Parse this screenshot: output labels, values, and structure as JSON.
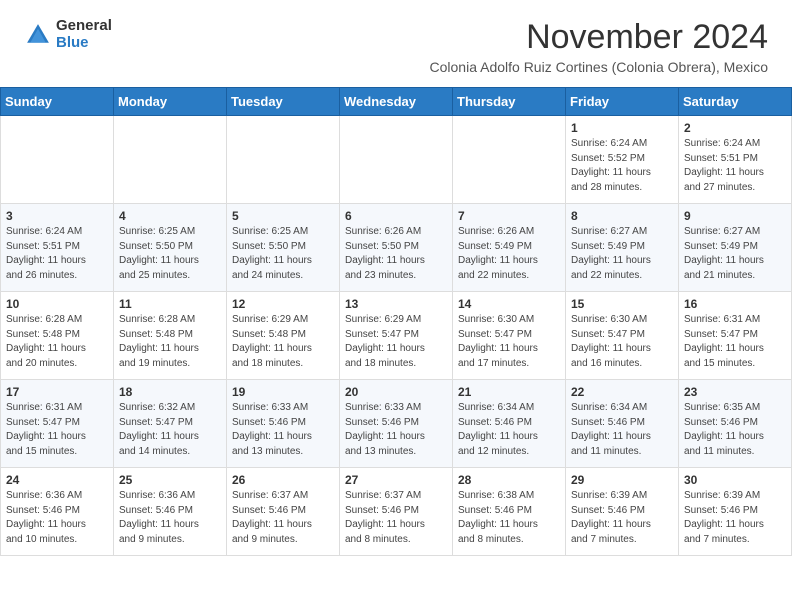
{
  "header": {
    "logo_general": "General",
    "logo_blue": "Blue",
    "month_title": "November 2024",
    "subtitle": "Colonia Adolfo Ruiz Cortines (Colonia Obrera), Mexico"
  },
  "days_of_week": [
    "Sunday",
    "Monday",
    "Tuesday",
    "Wednesday",
    "Thursday",
    "Friday",
    "Saturday"
  ],
  "weeks": [
    [
      {
        "num": "",
        "detail": ""
      },
      {
        "num": "",
        "detail": ""
      },
      {
        "num": "",
        "detail": ""
      },
      {
        "num": "",
        "detail": ""
      },
      {
        "num": "",
        "detail": ""
      },
      {
        "num": "1",
        "detail": "Sunrise: 6:24 AM\nSunset: 5:52 PM\nDaylight: 11 hours\nand 28 minutes."
      },
      {
        "num": "2",
        "detail": "Sunrise: 6:24 AM\nSunset: 5:51 PM\nDaylight: 11 hours\nand 27 minutes."
      }
    ],
    [
      {
        "num": "3",
        "detail": "Sunrise: 6:24 AM\nSunset: 5:51 PM\nDaylight: 11 hours\nand 26 minutes."
      },
      {
        "num": "4",
        "detail": "Sunrise: 6:25 AM\nSunset: 5:50 PM\nDaylight: 11 hours\nand 25 minutes."
      },
      {
        "num": "5",
        "detail": "Sunrise: 6:25 AM\nSunset: 5:50 PM\nDaylight: 11 hours\nand 24 minutes."
      },
      {
        "num": "6",
        "detail": "Sunrise: 6:26 AM\nSunset: 5:50 PM\nDaylight: 11 hours\nand 23 minutes."
      },
      {
        "num": "7",
        "detail": "Sunrise: 6:26 AM\nSunset: 5:49 PM\nDaylight: 11 hours\nand 22 minutes."
      },
      {
        "num": "8",
        "detail": "Sunrise: 6:27 AM\nSunset: 5:49 PM\nDaylight: 11 hours\nand 22 minutes."
      },
      {
        "num": "9",
        "detail": "Sunrise: 6:27 AM\nSunset: 5:49 PM\nDaylight: 11 hours\nand 21 minutes."
      }
    ],
    [
      {
        "num": "10",
        "detail": "Sunrise: 6:28 AM\nSunset: 5:48 PM\nDaylight: 11 hours\nand 20 minutes."
      },
      {
        "num": "11",
        "detail": "Sunrise: 6:28 AM\nSunset: 5:48 PM\nDaylight: 11 hours\nand 19 minutes."
      },
      {
        "num": "12",
        "detail": "Sunrise: 6:29 AM\nSunset: 5:48 PM\nDaylight: 11 hours\nand 18 minutes."
      },
      {
        "num": "13",
        "detail": "Sunrise: 6:29 AM\nSunset: 5:47 PM\nDaylight: 11 hours\nand 18 minutes."
      },
      {
        "num": "14",
        "detail": "Sunrise: 6:30 AM\nSunset: 5:47 PM\nDaylight: 11 hours\nand 17 minutes."
      },
      {
        "num": "15",
        "detail": "Sunrise: 6:30 AM\nSunset: 5:47 PM\nDaylight: 11 hours\nand 16 minutes."
      },
      {
        "num": "16",
        "detail": "Sunrise: 6:31 AM\nSunset: 5:47 PM\nDaylight: 11 hours\nand 15 minutes."
      }
    ],
    [
      {
        "num": "17",
        "detail": "Sunrise: 6:31 AM\nSunset: 5:47 PM\nDaylight: 11 hours\nand 15 minutes."
      },
      {
        "num": "18",
        "detail": "Sunrise: 6:32 AM\nSunset: 5:47 PM\nDaylight: 11 hours\nand 14 minutes."
      },
      {
        "num": "19",
        "detail": "Sunrise: 6:33 AM\nSunset: 5:46 PM\nDaylight: 11 hours\nand 13 minutes."
      },
      {
        "num": "20",
        "detail": "Sunrise: 6:33 AM\nSunset: 5:46 PM\nDaylight: 11 hours\nand 13 minutes."
      },
      {
        "num": "21",
        "detail": "Sunrise: 6:34 AM\nSunset: 5:46 PM\nDaylight: 11 hours\nand 12 minutes."
      },
      {
        "num": "22",
        "detail": "Sunrise: 6:34 AM\nSunset: 5:46 PM\nDaylight: 11 hours\nand 11 minutes."
      },
      {
        "num": "23",
        "detail": "Sunrise: 6:35 AM\nSunset: 5:46 PM\nDaylight: 11 hours\nand 11 minutes."
      }
    ],
    [
      {
        "num": "24",
        "detail": "Sunrise: 6:36 AM\nSunset: 5:46 PM\nDaylight: 11 hours\nand 10 minutes."
      },
      {
        "num": "25",
        "detail": "Sunrise: 6:36 AM\nSunset: 5:46 PM\nDaylight: 11 hours\nand 9 minutes."
      },
      {
        "num": "26",
        "detail": "Sunrise: 6:37 AM\nSunset: 5:46 PM\nDaylight: 11 hours\nand 9 minutes."
      },
      {
        "num": "27",
        "detail": "Sunrise: 6:37 AM\nSunset: 5:46 PM\nDaylight: 11 hours\nand 8 minutes."
      },
      {
        "num": "28",
        "detail": "Sunrise: 6:38 AM\nSunset: 5:46 PM\nDaylight: 11 hours\nand 8 minutes."
      },
      {
        "num": "29",
        "detail": "Sunrise: 6:39 AM\nSunset: 5:46 PM\nDaylight: 11 hours\nand 7 minutes."
      },
      {
        "num": "30",
        "detail": "Sunrise: 6:39 AM\nSunset: 5:46 PM\nDaylight: 11 hours\nand 7 minutes."
      }
    ]
  ]
}
